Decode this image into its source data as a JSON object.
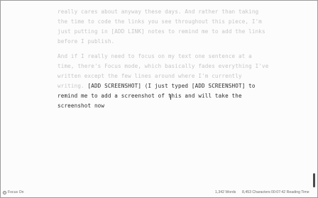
{
  "editor": {
    "faded_paragraph_1": [
      "really cares about anyway these days. And rather than taking",
      "the time to code the links you see throughout this piece, I'm",
      "just putting in [ADD LINK] notes to remind me to add the links",
      "before I publish."
    ],
    "faded_paragraph_2": [
      "And if I really need to focus on my text one sentence at a",
      "time, there's Focus mode, which basically fades everything I've",
      "written except the few lines around where I'm currently"
    ],
    "line_split": {
      "faded_part": "writing. ",
      "focused_part": "[ADD SCREENSHOT] (I just typed [ADD SCREENSHOT] to"
    },
    "focused_lines": [
      "remind me to add a screenshot of this and will take the",
      "screenshot now"
    ],
    "cursor_glyph": "I"
  },
  "statusbar": {
    "focus_label": "Focus On",
    "words": "1,342 Words",
    "characters": "8,453 Characters",
    "reading_time": "00:07:42 Reading Time"
  },
  "colors": {
    "faded_text": "#c6c6c6",
    "focused_text": "#2b2b2b",
    "background": "#fcfcfc"
  }
}
